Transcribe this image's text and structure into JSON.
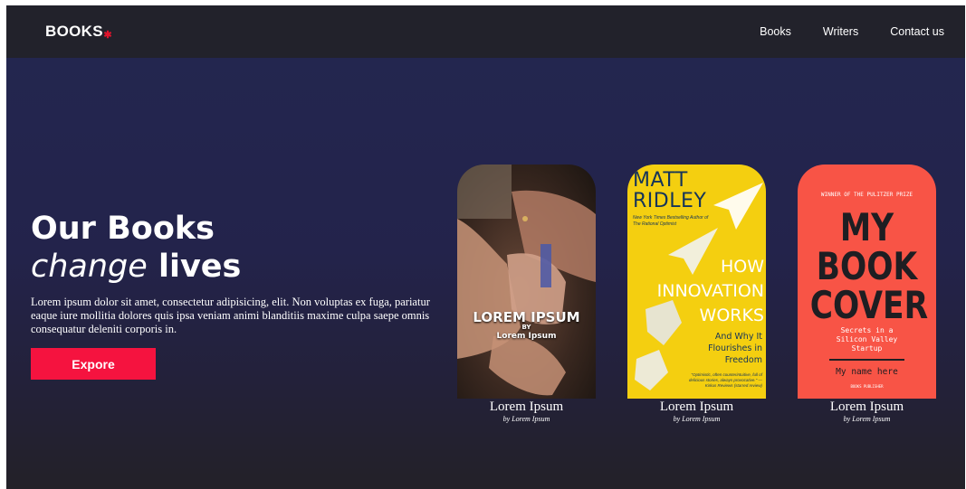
{
  "nav": {
    "logo": "BOOKS",
    "logo_mark": "✱",
    "links": [
      "Books",
      "Writers",
      "Contact us"
    ]
  },
  "hero": {
    "title_line1": "Our Books",
    "title_line2_italic": "change",
    "title_line2_bold": "lives",
    "description": "Lorem ipsum dolor sit amet, consectetur adipisicing, elit. Non voluptas ex fuga, pariatur eaque iure mollitia dolores quis ipsa veniam animi blanditiis maxime culpa saepe omnis consequatur deleniti corporis in.",
    "cta_label": "Expore"
  },
  "books": [
    {
      "title": "Lorem Ipsum",
      "author": "by Lorem Ipsum",
      "cover": {
        "title": "LOREM IPSUM",
        "by": "BY",
        "author": "Lorem Ipsum"
      }
    },
    {
      "title": "Lorem Ipsum",
      "author": "by Lorem Ipsum",
      "cover": {
        "author_first": "MATT",
        "author_last": "RIDLEY",
        "tagline1": "New York Times Bestselling Author of",
        "tagline2": "The Rational Optimist",
        "title1": "HOW",
        "title2": "INNOVATION",
        "title3": "WORKS",
        "subtitle1": "And Why It",
        "subtitle2": "Flourishes in",
        "subtitle3": "Freedom",
        "quote": "\"Optimistic, often counterintuitive, full of delicious stories, always provocative.\" —Kirkus Reviews (starred review)"
      }
    },
    {
      "title": "Lorem Ipsum",
      "author": "by Lorem Ipsum",
      "cover": {
        "award": "WINNER OF THE PULITZER PRIZE",
        "title1": "MY",
        "title2": "BOOK",
        "title3": "COVER",
        "sub1": "Secrets in a",
        "sub2": "Silicon Valley",
        "sub3": "Startup",
        "name": "My name here",
        "publisher": "BOOKS PUBLISHER"
      }
    }
  ],
  "colors": {
    "nav_bg": "#22222b",
    "hero_top": "#23264f",
    "hero_bottom": "#232128",
    "accent": "#f5133f",
    "cover2_bg": "#f4cf10",
    "cover3_bg": "#f85446"
  }
}
